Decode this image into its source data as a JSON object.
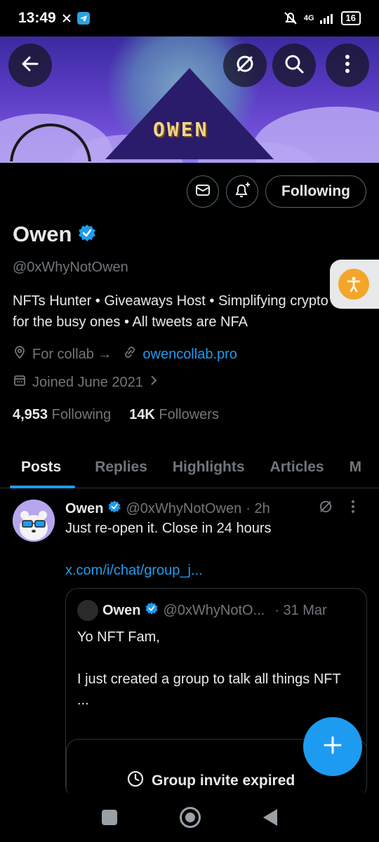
{
  "status_bar": {
    "time": "13:49",
    "network": "4G",
    "battery": "16",
    "app_icons": [
      "x-icon",
      "telegram-icon"
    ]
  },
  "header": {
    "banner_text": "OWEN",
    "back_icon": "arrow-left-icon",
    "grok_icon": "grok-icon",
    "search_icon": "search-icon",
    "more_icon": "more-vertical-icon"
  },
  "actions": {
    "message_icon": "mail-icon",
    "notify_icon": "bell-plus-icon",
    "follow_label": "Following"
  },
  "profile": {
    "name": "Owen",
    "verified": true,
    "handle": "@0xWhyNotOwen",
    "bio": "NFTs Hunter • Giveaways Host • Simplifying crypto for the busy ones • All tweets are NFA",
    "location": "For collab →",
    "website": "owencollab.pro",
    "joined": "Joined June 2021",
    "following_count": "4,953",
    "following_label": "Following",
    "followers_count": "14K",
    "followers_label": "Followers"
  },
  "tabs": [
    "Posts",
    "Replies",
    "Highlights",
    "Articles",
    "M"
  ],
  "post": {
    "author": "Owen",
    "handle": "@0xWhyNotOwen",
    "time": "· 2h",
    "text": "Just re-open it. Close in 24 hours",
    "link": "x.com/i/chat/group_j...",
    "quote": {
      "author": "Owen",
      "handle": "@0xWhyNotO...",
      "time": "· 31 Mar",
      "text": "Yo NFT Fam,\n\n  I just created a group to talk all things NFT\n...",
      "invite_status": "Group invite expired"
    }
  },
  "colors": {
    "accent": "#1d9bf0",
    "background": "#000000",
    "secondary_text": "#71767b",
    "border": "#2f3336"
  }
}
